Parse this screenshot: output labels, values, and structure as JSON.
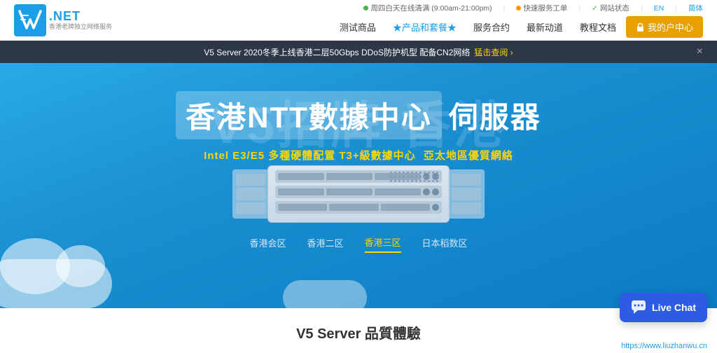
{
  "topbar": {
    "logo_net": ".NET",
    "logo_sub": "香港老牌独立网络服务",
    "info_items": [
      {
        "id": "online",
        "icon": "dot-green",
        "text": "周四白天在线清满 (9:00am-21:00pm)"
      },
      {
        "id": "service",
        "icon": "dot-orange",
        "text": "快速服务工单"
      },
      {
        "id": "status",
        "icon": "check",
        "text": "网站状态"
      },
      {
        "id": "lang",
        "text": "EN"
      },
      {
        "id": "lang2",
        "text": "简体"
      }
    ]
  },
  "nav": {
    "items": [
      {
        "id": "products",
        "label": "测试商品"
      },
      {
        "id": "brand",
        "label": "★产品和套餐★"
      },
      {
        "id": "contract",
        "label": "服务合约"
      },
      {
        "id": "news",
        "label": "最新动道"
      },
      {
        "id": "docs",
        "label": "教程文档"
      }
    ],
    "cta_label": "我的户中心",
    "cta_icon": "lock-icon"
  },
  "announcement": {
    "text": "V5 Server 2020冬季上线香港二层50Gbps DDoS防护机型 配备CN2网络",
    "link_text": "猛击查阅 ›",
    "close_label": "×"
  },
  "hero": {
    "bg_text": "V5招牌  香港",
    "title_box": "香港NTT數據中心",
    "title_suffix": "伺服器",
    "subtitle_main": "Intel E3/E5 多種硬體配置 T3+級數據中心",
    "subtitle_link": "亞太地區優質網絡",
    "tabs": [
      {
        "id": "hk1",
        "label": "香港会区",
        "active": false
      },
      {
        "id": "hk2",
        "label": "香港二区",
        "active": false
      },
      {
        "id": "hk3",
        "label": "香港三区",
        "active": true
      },
      {
        "id": "jp",
        "label": "日本稻数区",
        "active": false
      }
    ]
  },
  "bottom": {
    "title": "V5 Server 品質體驗"
  },
  "live_chat": {
    "label": "Live Chat",
    "icon": "chat-icon"
  },
  "url_bar": {
    "url": "https://www.liuzhanwu.cn"
  }
}
